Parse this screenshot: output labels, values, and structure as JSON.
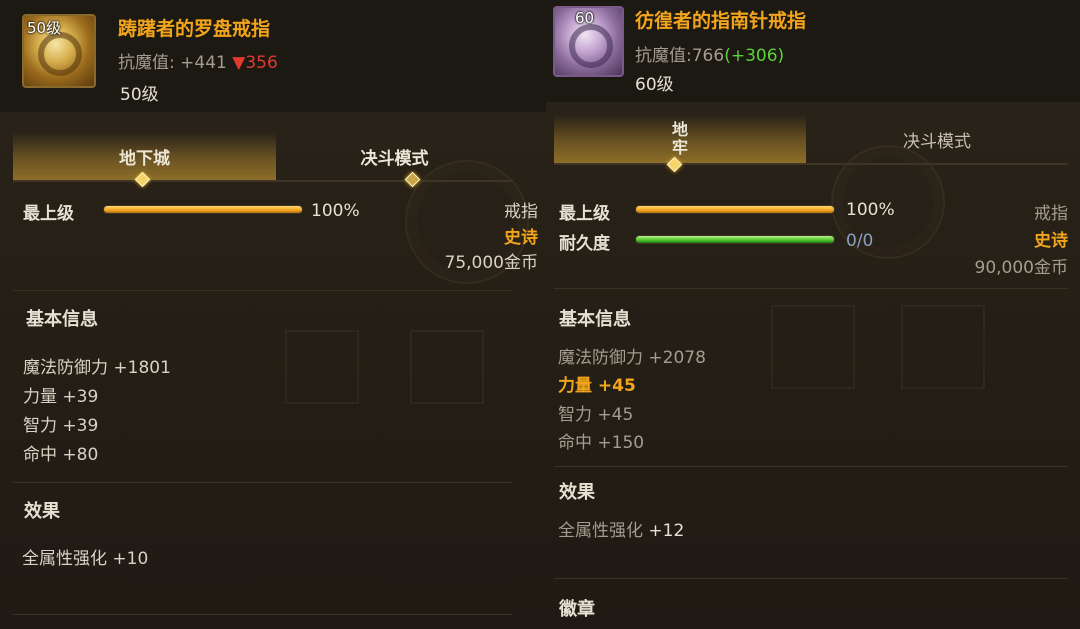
{
  "left": {
    "icon": {
      "name": "gold-compass-ring-icon",
      "level_tag": "50级"
    },
    "name": "踌躇者的罗盘戒指",
    "resist": {
      "label": "抗魔值:",
      "value": "+441",
      "arrow": "▼",
      "delta": "356"
    },
    "level": "50级",
    "tabs": [
      {
        "label": "地下城",
        "active": true
      },
      {
        "label": "决斗模式",
        "active": false
      }
    ],
    "bars": [
      {
        "label": "最上级",
        "percent": "100%",
        "fill": 1.0,
        "color": "#f2a51c"
      }
    ],
    "meta": {
      "type": "戒指",
      "rarity": "史诗",
      "price": "75,000金币"
    },
    "sections": {
      "basic": "基本信息",
      "effect": "效果"
    },
    "basic_attrs": [
      "魔法防御力 +1801",
      "力量 +39",
      "智力 +39",
      "命中 +80"
    ],
    "effect_attrs": [
      "全属性强化 +10"
    ]
  },
  "right": {
    "icon": {
      "name": "purple-compass-ring-icon",
      "level_tag": "60"
    },
    "name": "彷徨者的指南针戒指",
    "resist": {
      "label": "抗魔值:",
      "value": "766",
      "bonus": "(+306)"
    },
    "level": "60级",
    "tabs": [
      {
        "label": "地\n牢",
        "active": true
      },
      {
        "label": "决斗模式",
        "active": false
      }
    ],
    "bars": [
      {
        "label": "最上级",
        "percent": "100%",
        "fill": 1.0,
        "color": "#f2a51c"
      },
      {
        "label": "耐久度",
        "percent": "0/0",
        "fill": 1.0,
        "color": "#4ec52a"
      }
    ],
    "meta": {
      "type": "戒指",
      "rarity": "史诗",
      "price": "90,000金币"
    },
    "sections": {
      "basic": "基本信息",
      "effect": "效果",
      "emblem": "徽章"
    },
    "basic_attrs": [
      "魔法防御力 +2078",
      "力量 +45",
      "智力 +45",
      "命中 +150"
    ],
    "effect_attr": {
      "label": "全属性强化 ",
      "value": "+12"
    }
  },
  "colors": {
    "accent_gold": "#f2a51c",
    "downgrade_red": "#e23a2e",
    "upgrade_green": "#5cd23a"
  }
}
